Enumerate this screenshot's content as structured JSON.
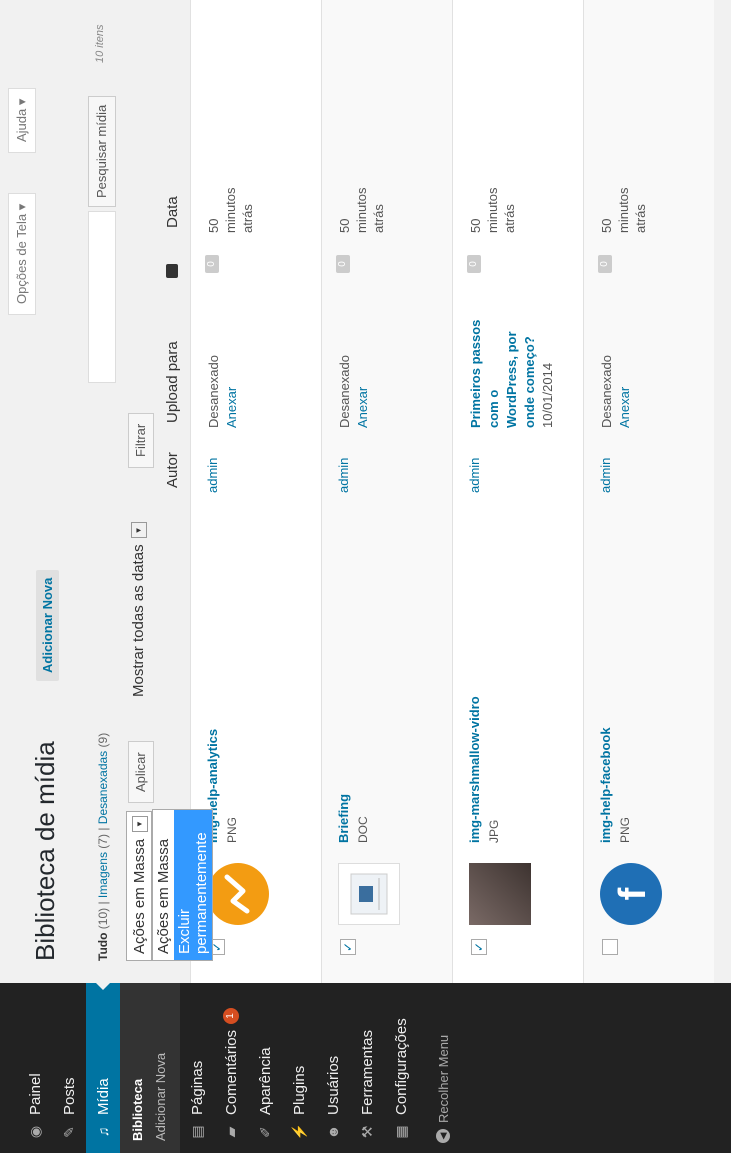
{
  "sidebar": {
    "items": [
      {
        "label": "Painel",
        "icon": "dashboard-icon"
      },
      {
        "label": "Posts",
        "icon": "pin-icon"
      },
      {
        "label": "Mídia",
        "icon": "media-icon"
      },
      {
        "label": "Páginas",
        "icon": "page-icon"
      },
      {
        "label": "Comentários",
        "icon": "comment-icon",
        "badge": "1"
      },
      {
        "label": "Aparência",
        "icon": "brush-icon"
      },
      {
        "label": "Plugins",
        "icon": "plug-icon"
      },
      {
        "label": "Usuários",
        "icon": "users-icon"
      },
      {
        "label": "Ferramentas",
        "icon": "wrench-icon"
      },
      {
        "label": "Configurações",
        "icon": "settings-icon"
      }
    ],
    "submenu": [
      "Biblioteca",
      "Adicionar Nova"
    ],
    "collapse": "Recolher Menu"
  },
  "topbar": {
    "screen_options": "Opções de Tela ▾",
    "help": "Ajuda ▾"
  },
  "page": {
    "title": "Biblioteca de mídia",
    "add_new": "Adicionar Nova"
  },
  "filters": {
    "all": "Tudo",
    "all_count": "(10)",
    "images": "Imagens",
    "images_count": "(7)",
    "unattached": "Desanexadas",
    "unattached_count": "(9)",
    "sep": "|"
  },
  "search": {
    "button": "Pesquisar mídia",
    "count": "10 itens"
  },
  "bulk": {
    "selected": "Ações em Massa",
    "options": [
      "Ações em Massa",
      "Excluir permanentemente"
    ],
    "apply": "Aplicar",
    "dates": "Mostrar todas as datas",
    "filter": "Filtrar"
  },
  "table": {
    "headers": {
      "author": "Autor",
      "uploaded_to": "Upload para",
      "date": "Data"
    },
    "rows": [
      {
        "name": "img-help-analytics",
        "type": "PNG",
        "author": "admin",
        "upload": "Desanexado",
        "attach": "Anexar",
        "comments": "0",
        "date": "50 minutos atrás",
        "checked": "✓"
      },
      {
        "name": "Briefing",
        "type": "DOC",
        "author": "admin",
        "upload": "Desanexado",
        "attach": "Anexar",
        "comments": "0",
        "date": "50 minutos atrás",
        "checked": "✓"
      },
      {
        "name": "img-marshmallow-vidro",
        "type": "JPG",
        "author": "admin",
        "upload_post": "Primeiros passos com o WordPress, por onde começo?",
        "upload_date": "10/01/2014",
        "comments": "0",
        "date": "50 minutos atrás",
        "checked": "✓"
      },
      {
        "name": "img-help-facebook",
        "type": "PNG",
        "author": "admin",
        "upload": "Desanexado",
        "attach": "Anexar",
        "comments": "0",
        "date": "50 minutos atrás",
        "checked": ""
      }
    ]
  },
  "colors": {
    "accent": "#0074a2",
    "sidebar_bg": "#222222",
    "highlight": "#3399ff",
    "analytics_orange": "#f39c12",
    "facebook_blue": "#1f6fb5"
  }
}
